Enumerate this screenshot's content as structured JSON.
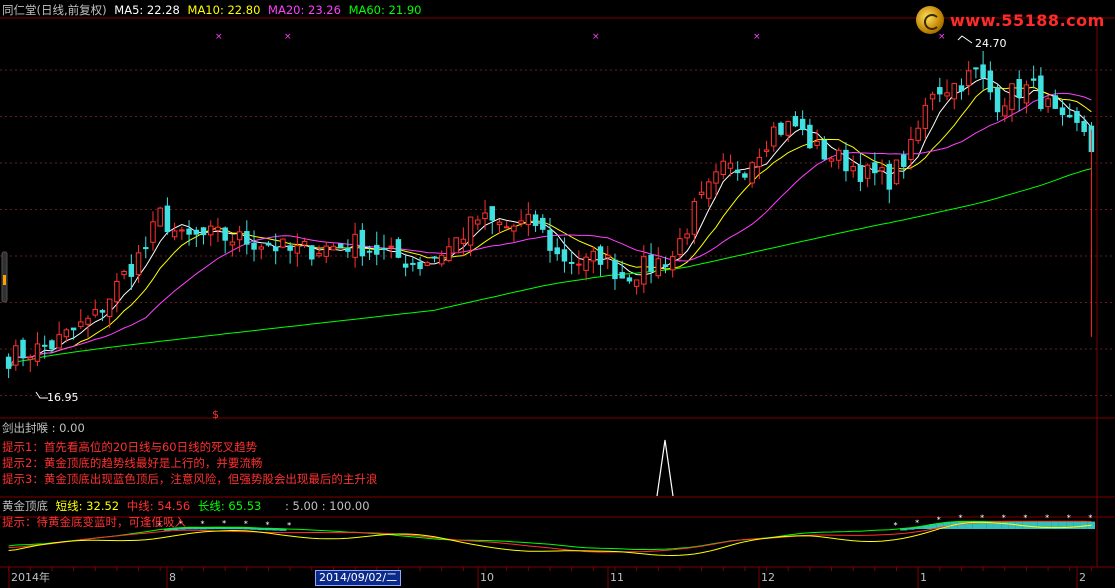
{
  "header": {
    "title": "同仁堂(日线,前复权)",
    "ma": [
      {
        "label": "MA5: 22.28",
        "color": "#ffffff"
      },
      {
        "label": "MA10: 22.80",
        "color": "#ffff00"
      },
      {
        "label": "MA20: 23.26",
        "color": "#ff40ff"
      },
      {
        "label": "MA60: 21.90",
        "color": "#00ff00"
      }
    ]
  },
  "watermark": {
    "text": "www.55188.com"
  },
  "indicator1": {
    "label": "剑出封喉 : 0.00"
  },
  "tips": [
    "提示1：首先看高位的20日线与60日线的死叉趋势",
    "提示2：黄金顶底的趋势线最好是上行的，并要流畅",
    "提示3：黄金顶底出现蓝色顶后，注意风险，但强势股会出现最后的主升浪"
  ],
  "indicator2": {
    "name": "黄金顶底",
    "short_label": "短线: 32.52",
    "mid_label": "中线: 54.56",
    "long_label": "长线: 65.53",
    "extra_label": ": 5.00 : 100.00",
    "tip": "提示：待黄金底变蓝时，可逢低吸入"
  },
  "xaxis": {
    "labels": [
      {
        "text": "2014年",
        "idx": 0
      },
      {
        "text": "8",
        "idx": 22
      },
      {
        "text": "10",
        "idx": 65
      },
      {
        "text": "11",
        "idx": 83
      },
      {
        "text": "12",
        "idx": 104
      },
      {
        "text": "1",
        "idx": 126
      },
      {
        "text": "2",
        "idx": 148
      }
    ],
    "cursor_date": "2014/09/02/二"
  },
  "chart_data": {
    "type": "candlestick",
    "n": 151,
    "price_range": [
      16.0,
      25.6
    ],
    "start_price": 17.3,
    "max_label": "24.70",
    "min_label": "16.95",
    "close_path": [
      [
        0,
        17.3
      ],
      [
        6,
        17.6
      ],
      [
        12,
        18.3
      ],
      [
        16,
        19.3
      ],
      [
        19,
        20.0
      ],
      [
        21,
        20.8
      ],
      [
        24,
        20.2
      ],
      [
        28,
        20.3
      ],
      [
        32,
        20.2
      ],
      [
        36,
        20.1
      ],
      [
        39,
        19.9
      ],
      [
        44,
        20.0
      ],
      [
        48,
        20.1
      ],
      [
        53,
        19.8
      ],
      [
        57,
        19.6
      ],
      [
        61,
        20.0
      ],
      [
        65,
        20.7
      ],
      [
        69,
        20.5
      ],
      [
        73,
        20.6
      ],
      [
        76,
        19.8
      ],
      [
        80,
        19.6
      ],
      [
        82,
        19.8
      ],
      [
        85,
        19.3
      ],
      [
        88,
        19.5
      ],
      [
        92,
        19.8
      ],
      [
        95,
        20.9
      ],
      [
        99,
        21.9
      ],
      [
        102,
        22.0
      ],
      [
        106,
        22.9
      ],
      [
        109,
        23.0
      ],
      [
        112,
        22.4
      ],
      [
        116,
        22.1
      ],
      [
        119,
        21.8
      ],
      [
        122,
        21.7
      ],
      [
        125,
        22.4
      ],
      [
        128,
        23.9
      ],
      [
        131,
        24.0
      ],
      [
        134,
        24.3
      ],
      [
        137,
        23.6
      ],
      [
        140,
        23.9
      ],
      [
        142,
        23.9
      ],
      [
        146,
        23.0
      ],
      [
        149,
        22.9
      ],
      [
        150,
        22.5
      ]
    ],
    "ma_colors": {
      "ma5": "#ffffff",
      "ma10": "#ffff00",
      "ma20": "#ff40ff",
      "ma60": "#00ff00"
    },
    "up_color": "#ff3030",
    "down_color": "#40e0e0",
    "indicator_short_color": "#ffff00",
    "indicator_mid_color": "#ff3030",
    "indicator_long_color": "#00ff00"
  }
}
